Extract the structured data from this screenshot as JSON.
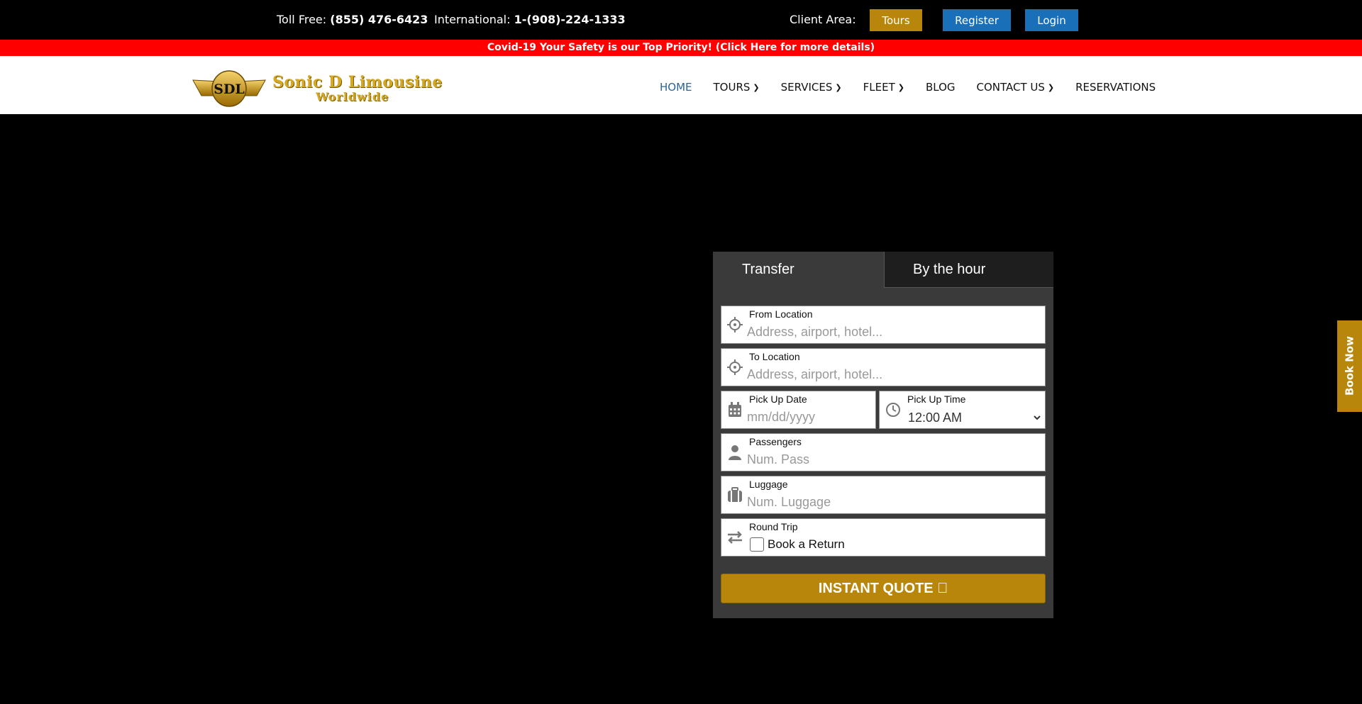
{
  "topbar": {
    "tollfree_label": "Toll Free:",
    "tollfree_number": "(855) 476-6423",
    "intl_label": "International:",
    "intl_number": "1-(908)-224-1333",
    "client_area_label": "Client Area:",
    "buttons": {
      "tours": "Tours",
      "register": "Register",
      "login": "Login"
    }
  },
  "banner": {
    "text": "Covid-19 Your Safety is our Top Priority! (Click Here for more details)"
  },
  "logo": {
    "line1": "Sonic D Limousine",
    "line2": "Worldwide",
    "emblem_text": "SDL"
  },
  "nav": {
    "items": [
      {
        "label": "HOME",
        "dropdown": false,
        "active": true
      },
      {
        "label": "TOURS",
        "dropdown": true,
        "active": false
      },
      {
        "label": "SERVICES",
        "dropdown": true,
        "active": false
      },
      {
        "label": "FLEET",
        "dropdown": true,
        "active": false
      },
      {
        "label": "BLOG",
        "dropdown": false,
        "active": false
      },
      {
        "label": "CONTACT US",
        "dropdown": true,
        "active": false
      },
      {
        "label": "RESERVATIONS",
        "dropdown": false,
        "active": false
      }
    ]
  },
  "booknow": {
    "label": "Book Now"
  },
  "booking": {
    "tabs": {
      "transfer": "Transfer",
      "hour": "By the hour"
    },
    "from": {
      "label": "From Location",
      "placeholder": "Address, airport, hotel..."
    },
    "to": {
      "label": "To Location",
      "placeholder": "Address, airport, hotel..."
    },
    "date": {
      "label": "Pick Up Date",
      "placeholder": "mm/dd/yyyy"
    },
    "time": {
      "label": "Pick Up Time",
      "value": "12:00 AM"
    },
    "passengers": {
      "label": "Passengers",
      "placeholder": "Num. Pass"
    },
    "luggage": {
      "label": "Luggage",
      "placeholder": "Num. Luggage"
    },
    "round_trip": {
      "label": "Round Trip",
      "checkbox_label": "Book a Return"
    },
    "quote_button": "INSTANT QUOTE "
  },
  "colors": {
    "gold": "#b8860b",
    "blue": "#1a6fb9",
    "banner_red": "#ff0000",
    "panel": "#3a3a3a"
  }
}
